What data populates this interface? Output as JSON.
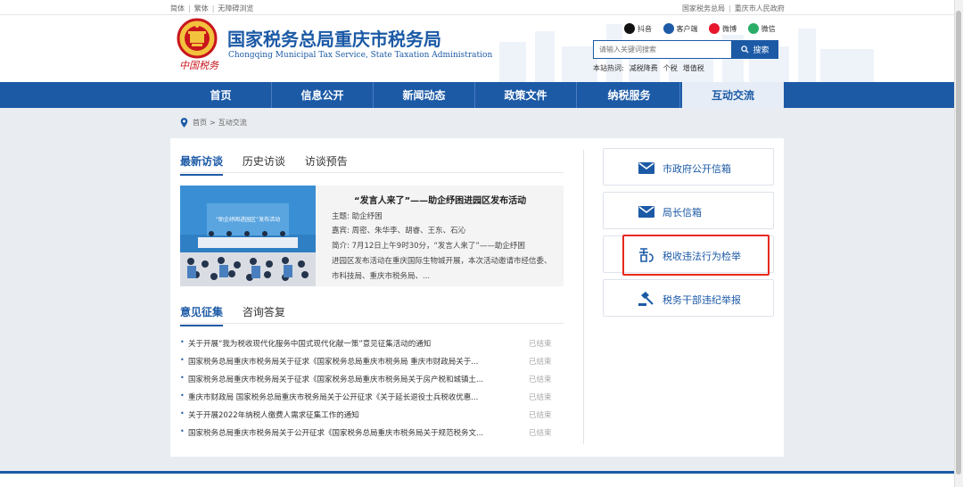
{
  "topbar": {
    "simplified": "简体",
    "traditional": "繁体",
    "accessible": "无障碍浏览",
    "link_sat": "国家税务总局",
    "link_gov": "重庆市人民政府"
  },
  "header": {
    "title": "国家税务总局重庆市税务局",
    "subtitle": "Chongqing Municipal Tax Service, State Taxation Administration",
    "calligraphy": "中国税务",
    "socials": [
      "抖音",
      "客户端",
      "微博",
      "微信"
    ],
    "search_placeholder": "请输入关键词搜索",
    "search_button": "搜索",
    "hotwords_label": "本站热词:",
    "hotwords": [
      "减税降费",
      "个税",
      "增值税"
    ]
  },
  "nav": {
    "items": [
      "首页",
      "信息公开",
      "新闻动态",
      "政策文件",
      "纳税服务",
      "互动交流"
    ],
    "active_index": 5
  },
  "breadcrumb": {
    "home": "首页",
    "sep": ">",
    "current": "互动交流"
  },
  "interview": {
    "tabs": [
      "最新访谈",
      "历史访谈",
      "访谈预告"
    ],
    "active_tab": 0,
    "title": "“发言人来了”——助企纾困进园区发布活动",
    "topic_label": "主题:",
    "topic": "助企纾困",
    "guests_label": "嘉宾:",
    "guests": "周密、朱华李、胡睿、王东、石沁",
    "intro_label": "简介:",
    "intro_first": "7月12日上午9时30分，“发言人来了”——助企纾困",
    "intro_rest": "进园区发布活动在重庆国际生物城开展，本次活动邀请市经信委、市科技局、重庆市税务局、...",
    "photo_banner": "“助企纾困进园区”发布活动"
  },
  "consult": {
    "tabs": [
      "意见征集",
      "咨询答复"
    ],
    "active_tab": 0,
    "items": [
      {
        "text": "关于开展“我为税收现代化服务中国式现代化献一策”意见征集活动的通知",
        "status": "已结束"
      },
      {
        "text": "国家税务总局重庆市税务局关于征求《国家税务总局重庆市税务局 重庆市财政局关于...",
        "status": "已结束"
      },
      {
        "text": "国家税务总局重庆市税务局关于征求《国家税务总局重庆市税务局关于房产税和城镇土...",
        "status": "已结束"
      },
      {
        "text": "重庆市财政局 国家税务总局重庆市税务局关于公开征求《关于延长退役士兵税收优惠...",
        "status": "已结束"
      },
      {
        "text": "关于开展2022年纳税人缴费人需求征集工作的通知",
        "status": "已结束"
      },
      {
        "text": "国家税务总局重庆市税务局关于公开征求《国家税务总局重庆市税务局关于规范税务文...",
        "status": "已结束"
      }
    ]
  },
  "sidebar": {
    "buttons": [
      {
        "label": "市政府公开信箱",
        "icon": "mail-icon"
      },
      {
        "label": "局长信箱",
        "icon": "mail-icon"
      },
      {
        "label": "税收违法行为检举",
        "icon": "tax-report-icon"
      },
      {
        "label": "税务干部违纪举报",
        "icon": "gavel-icon"
      }
    ],
    "highlighted_index": 2
  },
  "colors": {
    "brand_blue": "#1c5aa6",
    "highlight_red": "#e8281e",
    "nav_active_bg": "#e6edf6"
  }
}
